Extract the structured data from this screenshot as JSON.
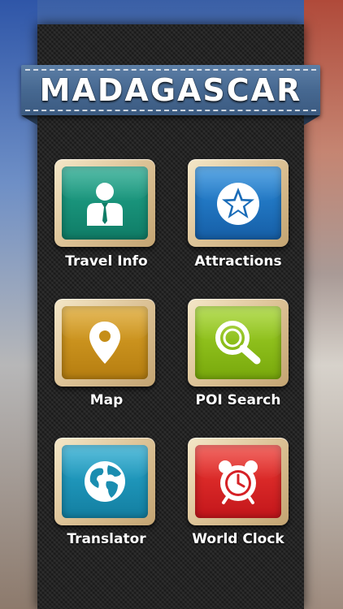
{
  "header": {
    "title": "MADAGASCAR"
  },
  "menu": {
    "items": [
      {
        "label": "Travel Info",
        "icon": "person-icon",
        "color": "#18917b"
      },
      {
        "label": "Attractions",
        "icon": "star-icon",
        "color": "#1f78c4"
      },
      {
        "label": "Map",
        "icon": "map-pin-icon",
        "color": "#cc9418"
      },
      {
        "label": "POI Search",
        "icon": "magnifier-icon",
        "color": "#8ec315"
      },
      {
        "label": "Translator",
        "icon": "globe-icon",
        "color": "#1c9bbd"
      },
      {
        "label": "World Clock",
        "icon": "alarm-clock-icon",
        "color": "#e02428"
      }
    ]
  }
}
